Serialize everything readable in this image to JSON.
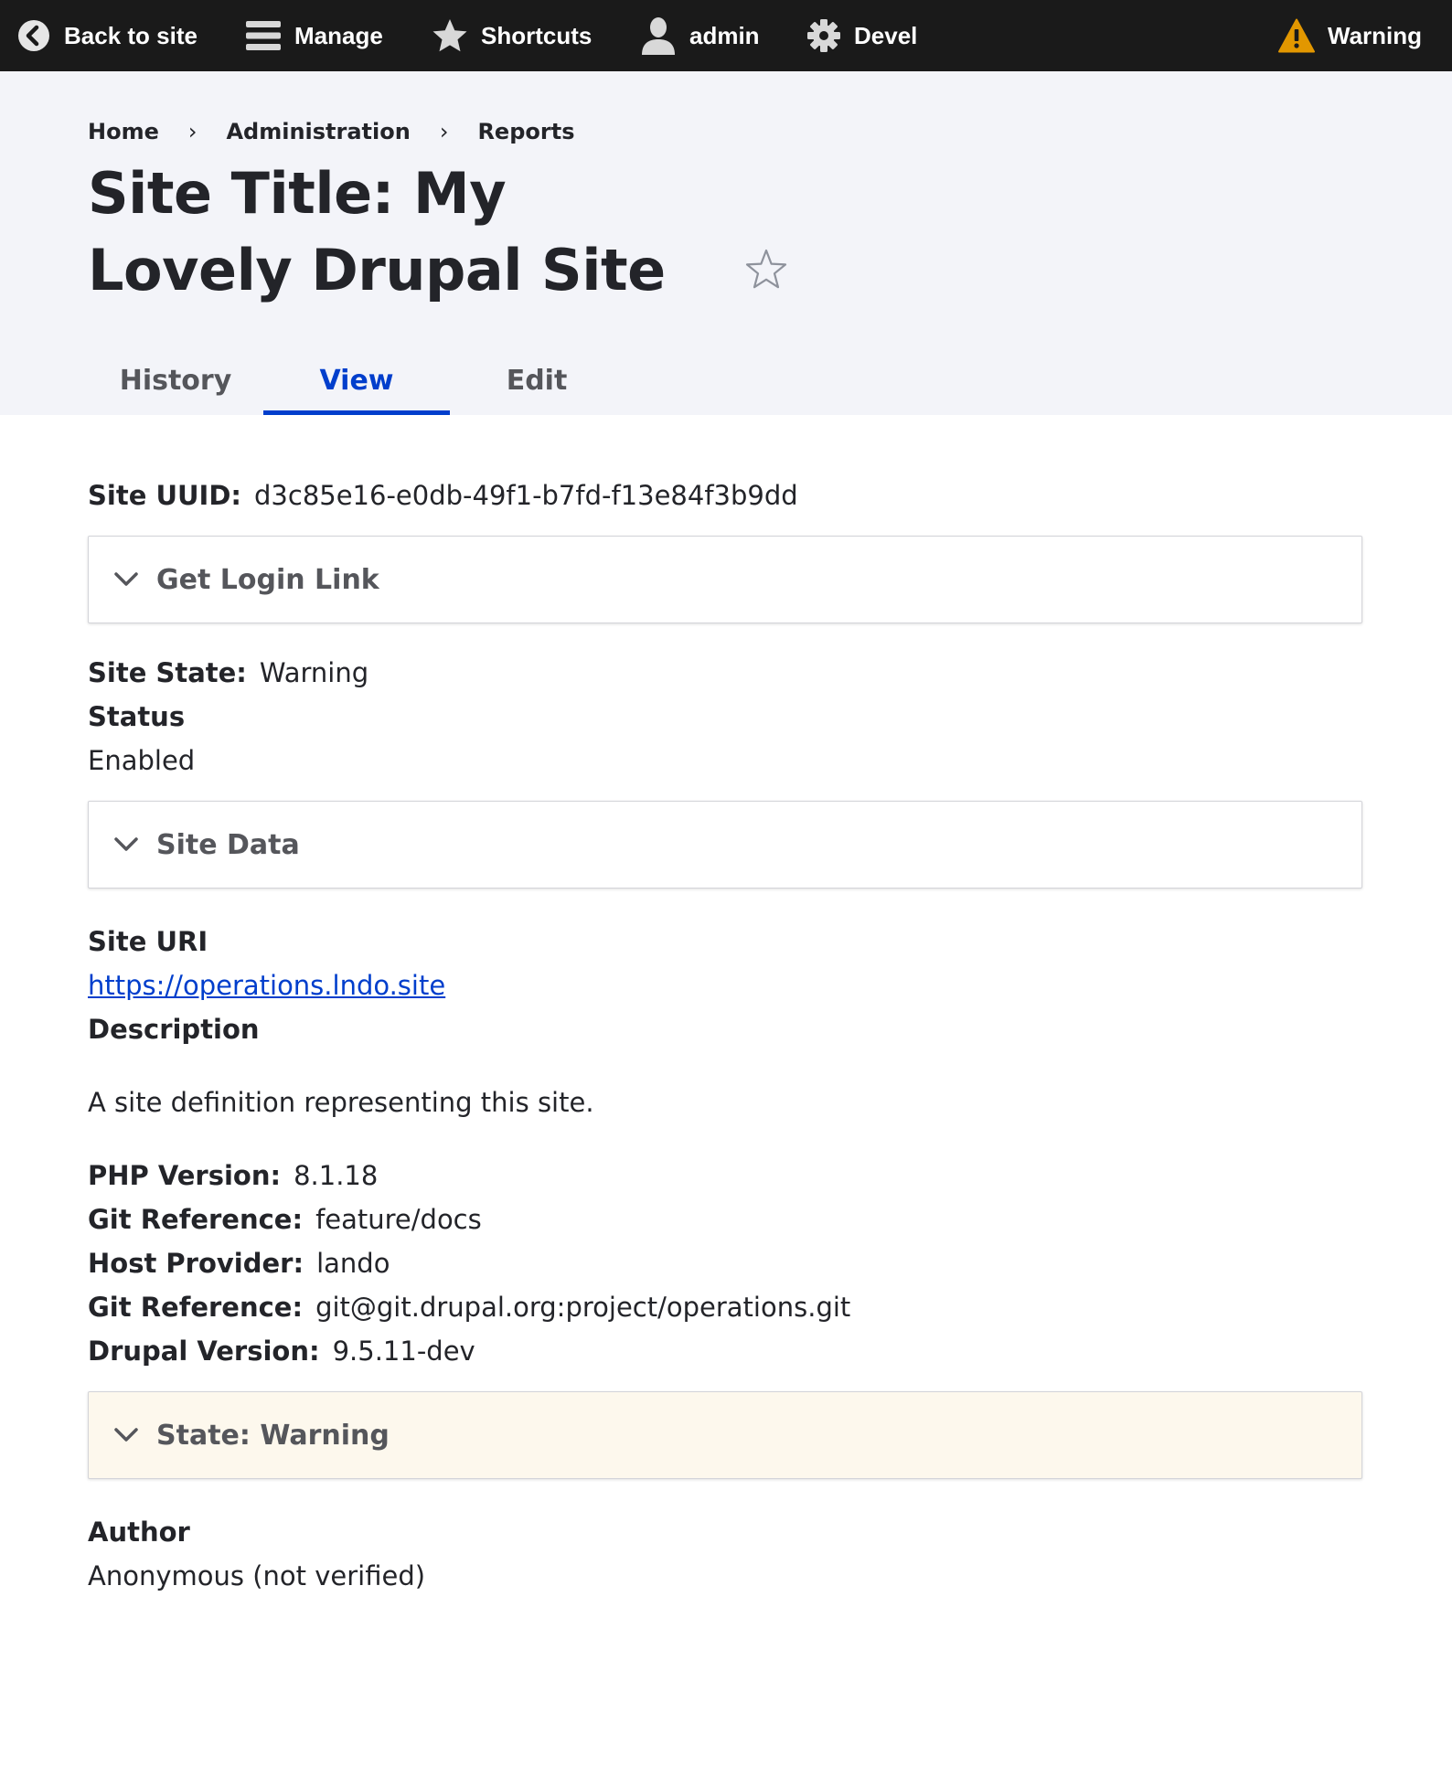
{
  "toolbar": {
    "back": "Back to site",
    "manage": "Manage",
    "shortcuts": "Shortcuts",
    "user": "admin",
    "devel": "Devel",
    "warning": "Warning"
  },
  "breadcrumb": [
    "Home",
    "Administration",
    "Reports"
  ],
  "page_title": "Site Title:  My Lovely Drupal Site",
  "tabs": [
    {
      "label": "History",
      "active": false
    },
    {
      "label": "View",
      "active": true
    },
    {
      "label": "Edit",
      "active": false
    }
  ],
  "fields": {
    "uuid_label": "Site UUID:",
    "uuid_value": "d3c85e16-e0db-49f1-b7fd-f13e84f3b9dd",
    "login_link": "Get Login Link",
    "state_label": "Site State:",
    "state_value": "Warning",
    "status_label": "Status",
    "status_value": "Enabled",
    "site_data": "Site Data",
    "uri_label": "Site URI",
    "uri_value": "https://operations.lndo.site",
    "description_label": "Description",
    "description_value": "A site definition representing this site.",
    "php_label": "PHP Version:",
    "php_value": "8.1.18",
    "git_ref_label": "Git Reference:",
    "git_ref_value": "feature/docs",
    "host_label": "Host Provider:",
    "host_value": "lando",
    "git_remote_label": "Git Reference:",
    "git_remote_value": "git@git.drupal.org:project/operations.git",
    "drupal_label": "Drupal Version:",
    "drupal_value": "9.5.11-dev",
    "state_details": "State: Warning",
    "author_label": "Author",
    "author_value": "Anonymous (not verified)"
  },
  "colors": {
    "toolbar_bg": "#1a1a1a",
    "header_bg": "#f3f4f9",
    "accent": "#003ecc",
    "warning": "#e29700",
    "warning_bg": "#fdf8ed"
  },
  "icons": [
    "back-circle-icon",
    "hamburger-icon",
    "star-icon",
    "user-icon",
    "gear-icon",
    "warning-triangle-icon",
    "star-outline-icon",
    "chevron-down-icon"
  ]
}
